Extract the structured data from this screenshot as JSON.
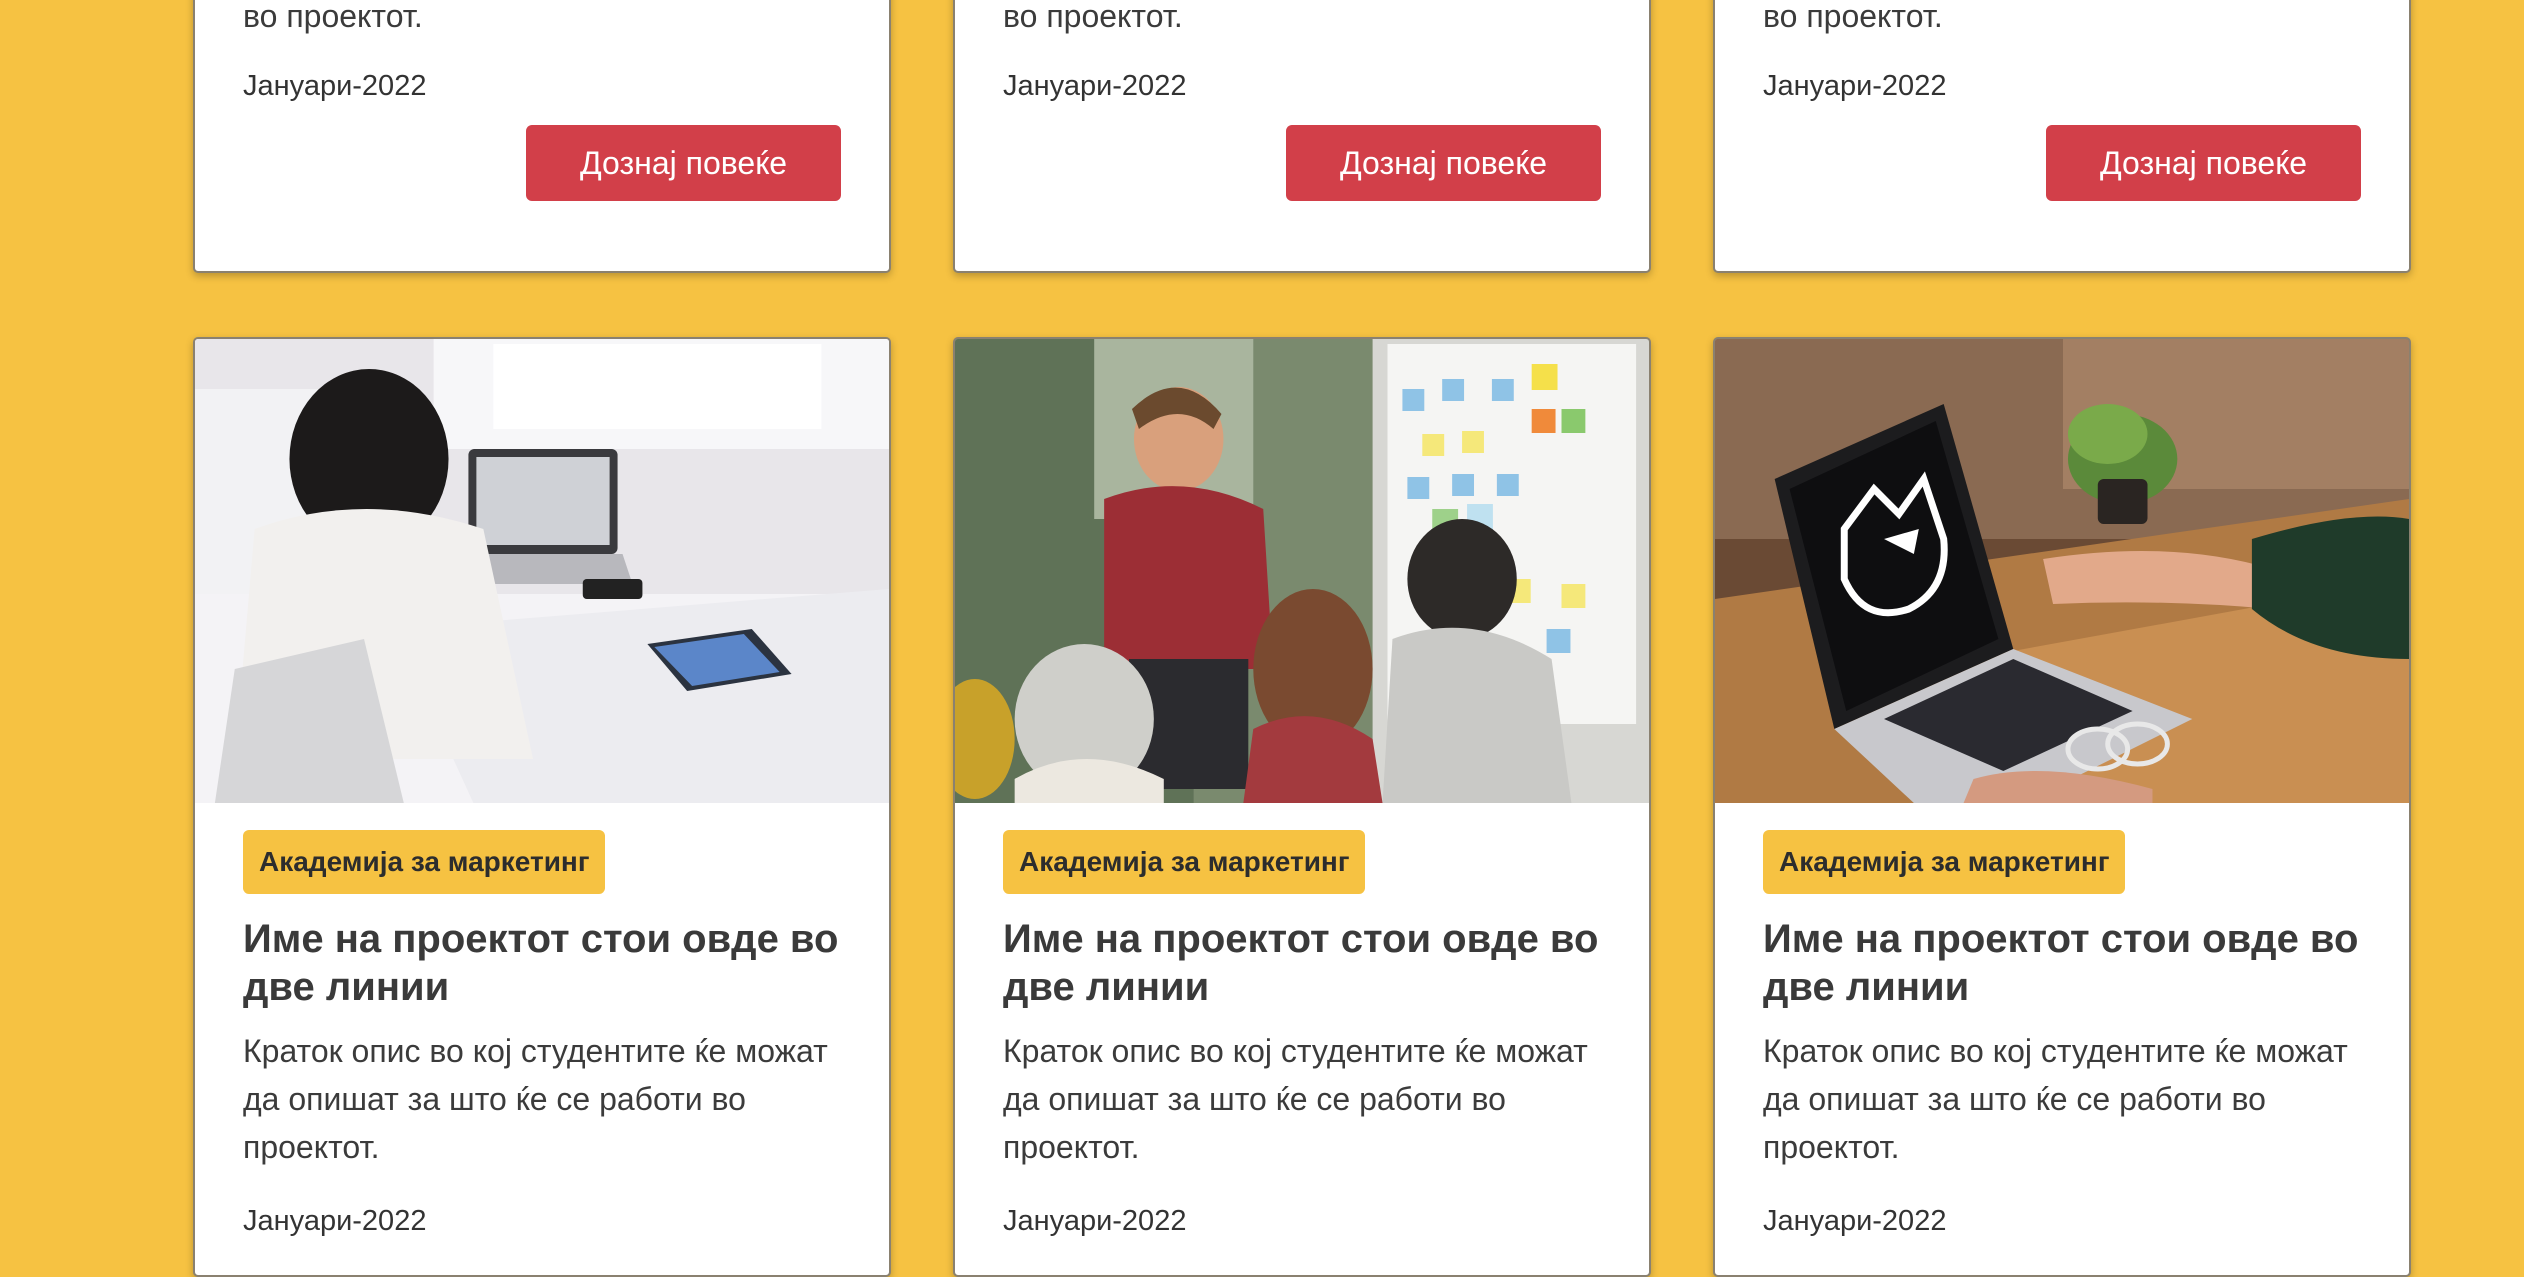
{
  "cards_top": [
    {
      "desc_tail": "во проектот.",
      "date": "Јануари-2022",
      "button": "Дознај повеќе"
    },
    {
      "desc_tail": "во проектот.",
      "date": "Јануари-2022",
      "button": "Дознај повеќе"
    },
    {
      "desc_tail": "во проектот.",
      "date": "Јануари-2022",
      "button": "Дознај повеќе"
    }
  ],
  "cards_bottom": [
    {
      "badge": "Академија за маркетинг",
      "title": "Име на проектот стои овде во две линии",
      "description": "Краток опис во кој студентите ќе можат да опишат за што ќе се работи во проектот.",
      "date": "Јануари-2022",
      "photo": "woman-at-laptop-photo"
    },
    {
      "badge": "Академија за маркетинг",
      "title": "Име на проектот стои овде во две линии",
      "description": "Краток опис во кој студентите ќе можат да опишат за што ќе се работи во проектот.",
      "date": "Јануари-2022",
      "photo": "presenter-at-whiteboard-photo"
    },
    {
      "badge": "Академија за маркетинг",
      "title": "Име на проектот стои овде во две линии",
      "description": "Краток опис во кој студентите ќе можат да опишат за што ќе се работи во проектот.",
      "date": "Јануари-2022",
      "photo": "laptop-with-logo-photo"
    }
  ],
  "colors": {
    "background": "#f6c242",
    "button": "#d23f49",
    "badge": "#f6c242"
  }
}
